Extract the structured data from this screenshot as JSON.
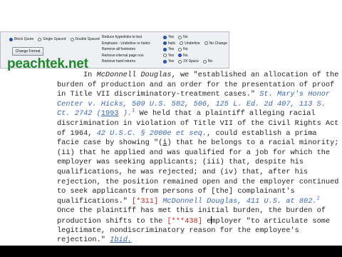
{
  "toolbar": {
    "spacing_options": [
      {
        "label": "Block Quote",
        "selected": true
      },
      {
        "label": "Single Spaced",
        "selected": false
      },
      {
        "label": "Double Spaced",
        "selected": false
      }
    ],
    "change_format_label": "Change Format",
    "settings": [
      {
        "label": "Reduce hyperlinks to text",
        "choices": [
          {
            "label": "Yes",
            "selected": true
          },
          {
            "label": "No",
            "selected": false
          }
        ]
      },
      {
        "label": "Emphasis - Underline or Italics",
        "choices": [
          {
            "label": "Italic",
            "selected": true
          },
          {
            "label": "Underline",
            "selected": false
          },
          {
            "label": "No Change",
            "selected": false
          }
        ]
      },
      {
        "label": "Remove all footnotes",
        "choices": [
          {
            "label": "Yes",
            "selected": true
          },
          {
            "label": "No",
            "selected": false
          }
        ]
      },
      {
        "label": "Remove internal page nos.",
        "choices": [
          {
            "label": "Yes",
            "selected": false
          },
          {
            "label": "No",
            "selected": true
          }
        ]
      },
      {
        "label": "Remove hard returns",
        "choices": [
          {
            "label": "Yes",
            "selected": true
          },
          {
            "label": "2X Space",
            "selected": false
          },
          {
            "label": "No",
            "selected": false
          }
        ]
      }
    ]
  },
  "brand": {
    "logo_text": "peachtek.net",
    "logo_color": "#1e8a2e"
  },
  "document": {
    "lines": [
      [
        {
          "t": "In "
        },
        {
          "t": "McDonnell Douglas",
          "c": "italic"
        },
        {
          "t": ", we \"established an allocation of the"
        }
      ],
      [
        {
          "t": "burden of production and an order for the presentation of proof"
        }
      ],
      [
        {
          "t": "in Title VII discriminatory-treatment cases.\" "
        },
        {
          "t": "St. Mary's Honor",
          "c": "cite"
        }
      ],
      [
        {
          "t": "Center v. Hicks, 509 U.S. 502, 506, 125 L. Ed. 2d 407, 113 S.",
          "c": "cite"
        }
      ],
      [
        {
          "t": "Ct. 2742 (",
          "c": "cite"
        },
        {
          "t": "1993",
          "c": "ulink"
        },
        {
          "t": " ).",
          "c": "cite"
        },
        {
          "t": "1",
          "c": "fn"
        },
        {
          "t": " We held that a plaintiff alleging racial"
        }
      ],
      [
        {
          "t": "discrimination in violation of Title VII of the Civil Rights Act"
        }
      ],
      [
        {
          "t": "of 1964, "
        },
        {
          "t": "42 U.S.C. § 2000e et seq.",
          "c": "cite"
        },
        {
          "t": ", could establish a prima"
        }
      ],
      [
        {
          "t": "facie case by showing \"("
        },
        {
          "t": "i",
          "c": "uplain"
        },
        {
          "t": ") that he belongs to a racial minority;"
        }
      ],
      [
        {
          "t": "(ii) that he applied and was qualified for a job for which the"
        }
      ],
      [
        {
          "t": "employer was seeking applicants; (iii) that, despite his"
        }
      ],
      [
        {
          "t": "qualifications, he was rejected; and (iv) that, after his"
        }
      ],
      [
        {
          "t": "rejection, the position remained open and the employer continued"
        }
      ],
      [
        {
          "t": "to seek applicants from persons of [the] complainant's"
        }
      ],
      [
        {
          "t": "qualifications.\" "
        },
        {
          "t": "[*311]",
          "c": "star"
        },
        {
          "t": " "
        },
        {
          "t": "McDonnell Douglas, 411 U.S. at 802.",
          "c": "cite"
        },
        {
          "t": "2",
          "c": "fn"
        }
      ],
      [
        {
          "t": "Once the plaintiff has met this initial burden, the burden of"
        }
      ],
      [
        {
          "t": "production shifts to the "
        },
        {
          "t": "[***438]",
          "c": "star"
        },
        {
          "t": " e"
        },
        {
          "t": "",
          "c": "cursor"
        },
        {
          "t": "mployer \"to articulate some"
        }
      ],
      [
        {
          "t": "legitimate, nondiscriminatory reason for the employee's"
        }
      ],
      [
        {
          "t": "rejection.\" "
        },
        {
          "t": "Ibid.",
          "c": "ulink-italic"
        }
      ]
    ]
  }
}
